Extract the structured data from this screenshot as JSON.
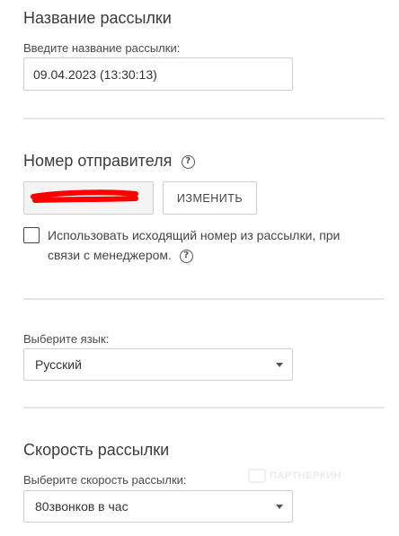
{
  "campaign_name": {
    "title": "Название рассылки",
    "label": "Введите название рассылки:",
    "value": "09.04.2023 (13:30:13)"
  },
  "sender": {
    "title": "Номер отправителя",
    "change_button": "ИЗМЕНИТЬ",
    "redaction_color": "#ff0000",
    "checkbox_label_line1": "Использовать исходящий номер из рассылки, при",
    "checkbox_label_line2": "связи с менеджером.",
    "checkbox_checked": false
  },
  "language": {
    "label": "Выберите язык:",
    "selected": "Русский"
  },
  "speed": {
    "title": "Скорость рассылки",
    "label": "Выберите скорость рассылки:",
    "selected": "80звонков в час"
  },
  "watermark": {
    "text": "ПАРТНЕРКИН"
  },
  "icons": {
    "help": "help-circle-icon",
    "dropdown": "caret-down-icon"
  }
}
